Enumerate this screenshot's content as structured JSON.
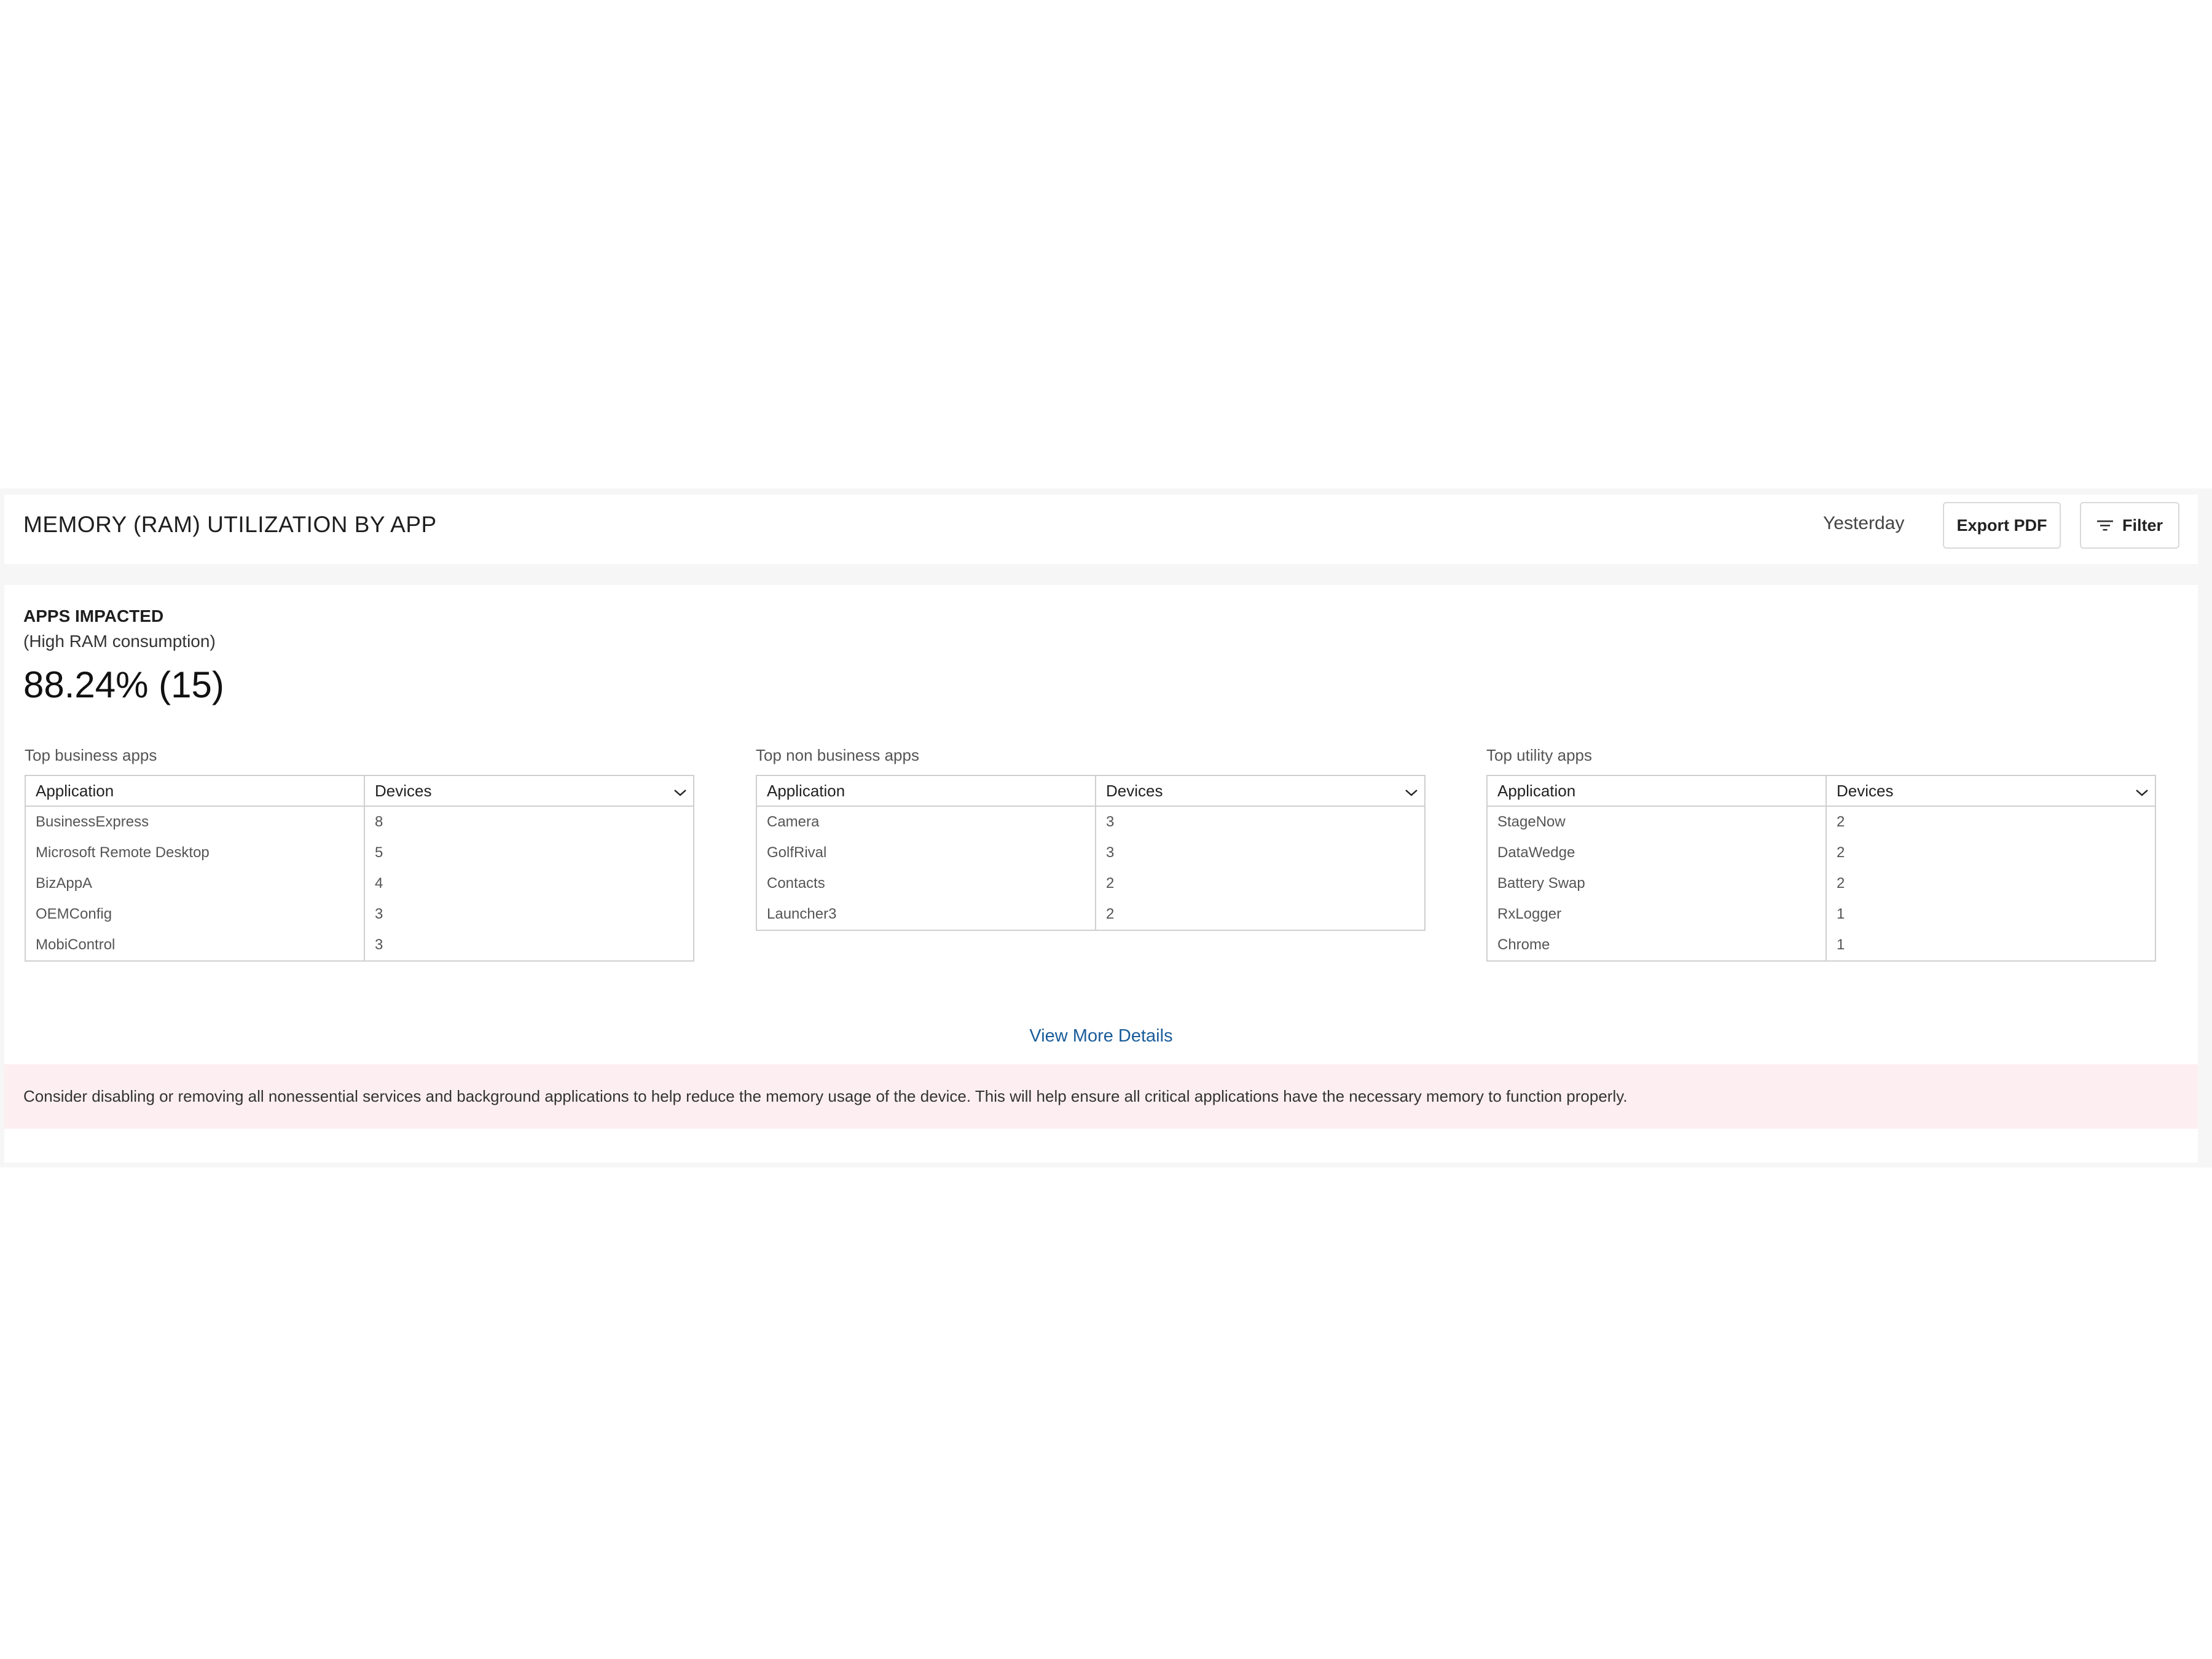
{
  "header": {
    "title": "MEMORY (RAM) UTILIZATION BY APP",
    "date_range": "Yesterday",
    "export_label": "Export PDF",
    "filter_label": "Filter"
  },
  "impact": {
    "title": "APPS IMPACTED",
    "subtitle": "(High RAM consumption)",
    "value": "88.24% (15)"
  },
  "tables": [
    {
      "caption": "Top business apps",
      "columns": [
        "Application",
        "Devices"
      ],
      "rows": [
        {
          "app": "BusinessExpress",
          "devices": "8"
        },
        {
          "app": "Microsoft Remote Desktop",
          "devices": "5"
        },
        {
          "app": "BizAppA",
          "devices": "4"
        },
        {
          "app": "OEMConfig",
          "devices": "3"
        },
        {
          "app": "MobiControl",
          "devices": "3"
        }
      ]
    },
    {
      "caption": "Top non business apps",
      "columns": [
        "Application",
        "Devices"
      ],
      "rows": [
        {
          "app": "Camera",
          "devices": "3"
        },
        {
          "app": "GolfRival",
          "devices": "3"
        },
        {
          "app": "Contacts",
          "devices": "2"
        },
        {
          "app": "Launcher3",
          "devices": "2"
        }
      ]
    },
    {
      "caption": "Top utility apps",
      "columns": [
        "Application",
        "Devices"
      ],
      "rows": [
        {
          "app": "StageNow",
          "devices": "2"
        },
        {
          "app": "DataWedge",
          "devices": "2"
        },
        {
          "app": "Battery Swap",
          "devices": "2"
        },
        {
          "app": "RxLogger",
          "devices": "1"
        },
        {
          "app": "Chrome",
          "devices": "1"
        }
      ]
    }
  ],
  "view_more_label": "View More Details",
  "advice_text": "Consider disabling or removing all nonessential services and background applications to help reduce the memory usage of the device. This will help ensure all critical applications have the necessary memory to function properly.",
  "icons": {
    "filter": "filter-icon",
    "sort": "chevron-down-icon"
  },
  "colors": {
    "link": "#1a5c9a",
    "advice_bg": "#fdeff1",
    "page_bg": "#f6f6f6"
  }
}
